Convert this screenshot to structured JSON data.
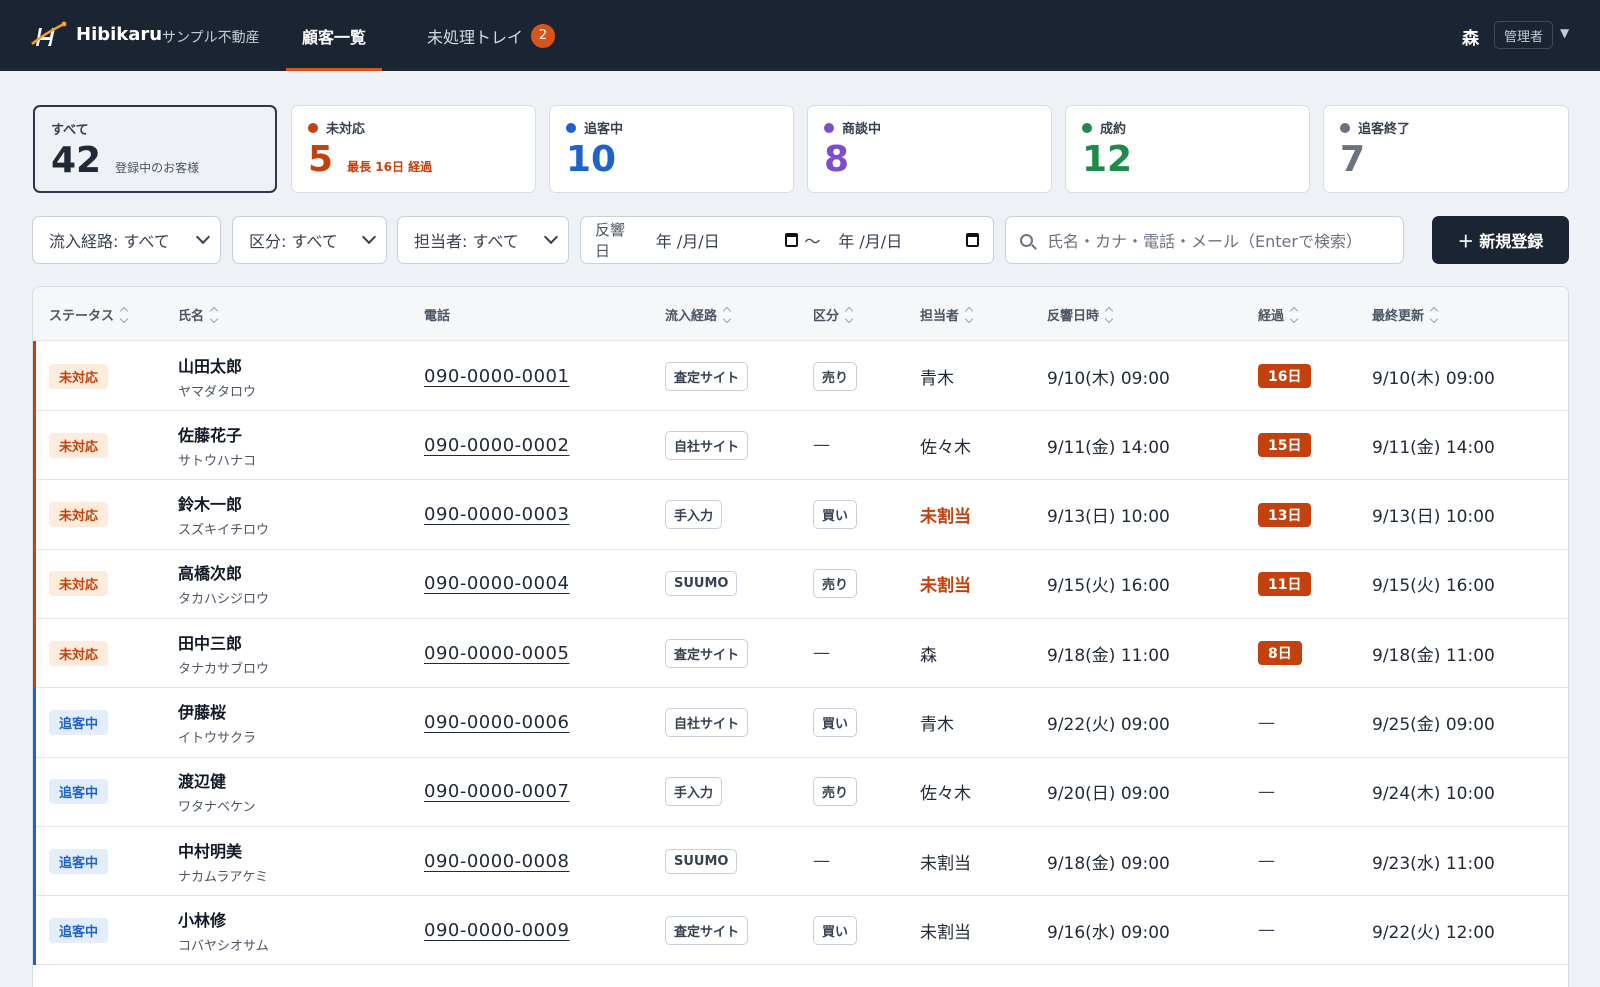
{
  "header": {
    "brand": "Hibikaru",
    "company": "サンプル不動産",
    "tabs": [
      {
        "label": "顧客一覧"
      },
      {
        "label": "未処理トレイ",
        "badge": "2"
      }
    ],
    "user": "森",
    "role": "管理者"
  },
  "stats": [
    {
      "label": "すべて",
      "count": "42",
      "sub": "登録中のお客様",
      "color": ""
    },
    {
      "label": "未対応",
      "count": "5",
      "sub": "最長 16日 経過",
      "color": "#c2410c"
    },
    {
      "label": "追客中",
      "count": "10",
      "sub": "",
      "color": "#1d63c9"
    },
    {
      "label": "商談中",
      "count": "8",
      "sub": "",
      "color": "#7c4dcc"
    },
    {
      "label": "成約",
      "count": "12",
      "sub": "",
      "color": "#1f8a4c"
    },
    {
      "label": "追客終了",
      "count": "7",
      "sub": "",
      "color": "#6b7280"
    }
  ],
  "filters": {
    "source": "流入経路: すべて",
    "category": "区分: すべて",
    "assignee": "担当者: すべて",
    "date_label": "反響日",
    "date_placeholder": "年 /月/日",
    "date_sep": "〜",
    "search_placeholder": "氏名・カナ・電話・メール（Enterで検索）",
    "new_button": "＋ 新規登録"
  },
  "table": {
    "columns": [
      "ステータス",
      "氏名",
      "電話",
      "流入経路",
      "区分",
      "担当者",
      "反響日時",
      "経過",
      "最終更新"
    ],
    "rows": [
      {
        "status": "未対応",
        "name": "山田太郎",
        "kana": "ヤマダタロウ",
        "phone": "090-0000-0001",
        "source": "査定サイト",
        "category": "売り",
        "assignee": "青木",
        "response": "9/10(木) 09:00",
        "elapsed": "16日",
        "updated": "9/10(木) 09:00"
      },
      {
        "status": "未対応",
        "name": "佐藤花子",
        "kana": "サトウハナコ",
        "phone": "090-0000-0002",
        "source": "自社サイト",
        "category": "—",
        "assignee": "佐々木",
        "response": "9/11(金) 14:00",
        "elapsed": "15日",
        "updated": "9/11(金) 14:00"
      },
      {
        "status": "未対応",
        "name": "鈴木一郎",
        "kana": "スズキイチロウ",
        "phone": "090-0000-0003",
        "source": "手入力",
        "category": "買い",
        "assignee": "未割当",
        "response": "9/13(日) 10:00",
        "elapsed": "13日",
        "updated": "9/13(日) 10:00"
      },
      {
        "status": "未対応",
        "name": "高橋次郎",
        "kana": "タカハシジロウ",
        "phone": "090-0000-0004",
        "source": "SUUMO",
        "category": "売り",
        "assignee": "未割当",
        "response": "9/15(火) 16:00",
        "elapsed": "11日",
        "updated": "9/15(火) 16:00"
      },
      {
        "status": "未対応",
        "name": "田中三郎",
        "kana": "タナカサブロウ",
        "phone": "090-0000-0005",
        "source": "査定サイト",
        "category": "—",
        "assignee": "森",
        "response": "9/18(金) 11:00",
        "elapsed": "8日",
        "updated": "9/18(金) 11:00"
      },
      {
        "status": "追客中",
        "name": "伊藤桜",
        "kana": "イトウサクラ",
        "phone": "090-0000-0006",
        "source": "自社サイト",
        "category": "買い",
        "assignee": "青木",
        "response": "9/22(火) 09:00",
        "elapsed": "—",
        "updated": "9/25(金) 09:00"
      },
      {
        "status": "追客中",
        "name": "渡辺健",
        "kana": "ワタナベケン",
        "phone": "090-0000-0007",
        "source": "手入力",
        "category": "売り",
        "assignee": "佐々木",
        "response": "9/20(日) 09:00",
        "elapsed": "—",
        "updated": "9/24(木) 10:00"
      },
      {
        "status": "追客中",
        "name": "中村明美",
        "kana": "ナカムラアケミ",
        "phone": "090-0000-0008",
        "source": "SUUMO",
        "category": "—",
        "assignee": "未割当",
        "response": "9/18(金) 09:00",
        "elapsed": "—",
        "updated": "9/23(水) 11:00"
      },
      {
        "status": "追客中",
        "name": "小林修",
        "kana": "コバヤシオサム",
        "phone": "090-0000-0009",
        "source": "査定サイト",
        "category": "買い",
        "assignee": "未割当",
        "response": "9/16(水) 09:00",
        "elapsed": "—",
        "updated": "9/22(火) 12:00"
      }
    ]
  }
}
